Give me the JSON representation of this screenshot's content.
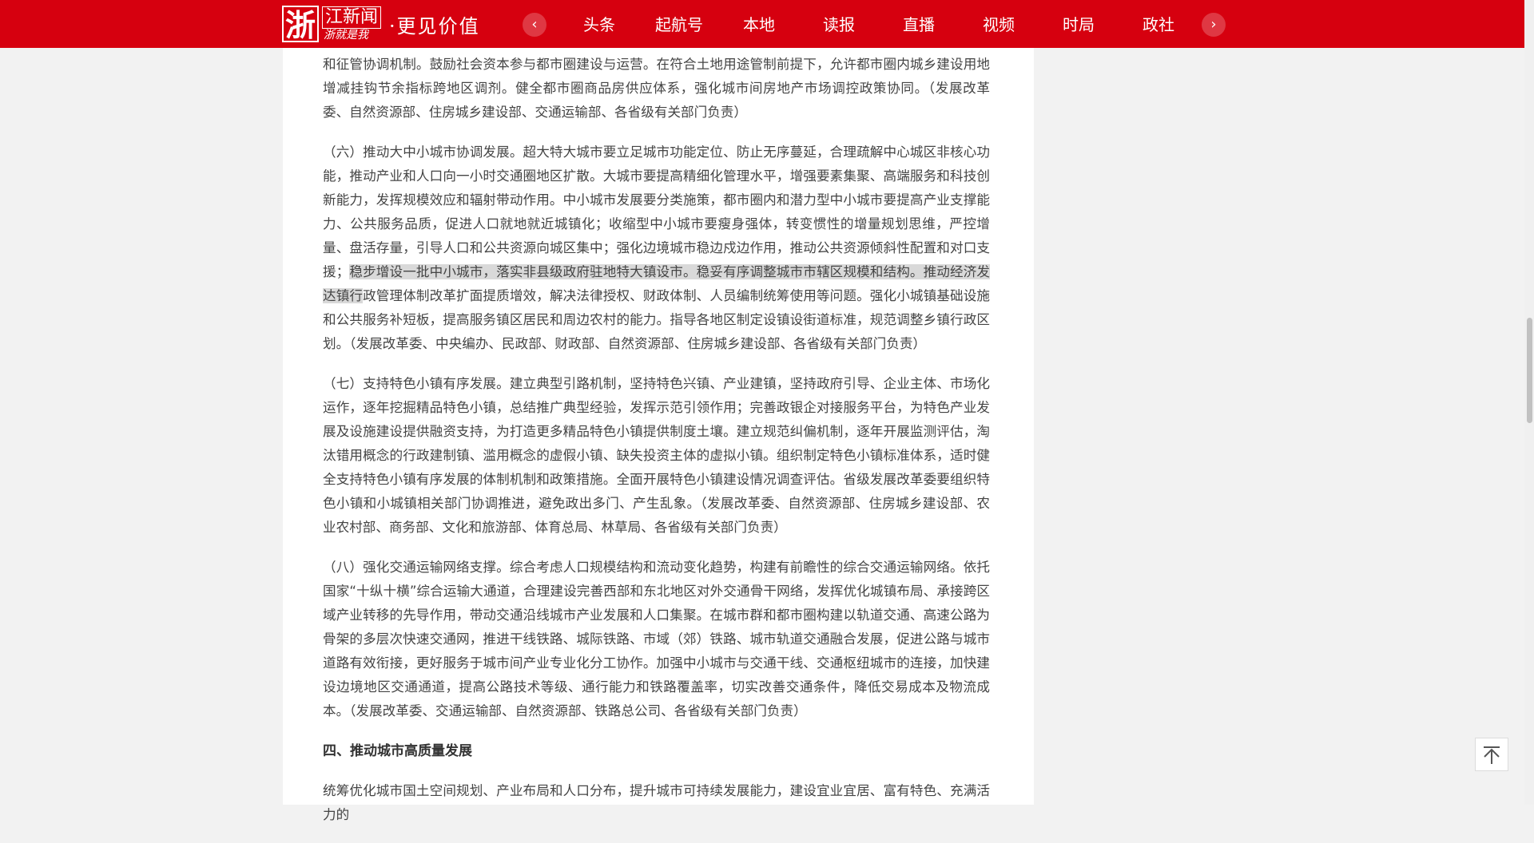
{
  "header": {
    "logo_char": "浙",
    "logo_name": "江新闻",
    "logo_sub": "浙就是我",
    "slogan": "·更见价值",
    "nav": [
      "头条",
      "起航号",
      "本地",
      "读报",
      "直播",
      "视频",
      "时局",
      "政社"
    ],
    "prev_icon": "chevron-left-icon",
    "next_icon": "chevron-right-icon"
  },
  "article": {
    "p0": "和征管协调机制。鼓励社会资本参与都市圈建设与运营。在符合土地用途管制前提下，允许都市圈内城乡建设用地增减挂钩节余指标跨地区调剂。健全都市圈商品房供应体系，强化城市间房地产市场调控政策协同。（发展改革委、自然资源部、住房城乡建设部、交通运输部、各省级有关部门负责）",
    "p1_before": "（六）推动大中小城市协调发展。超大特大城市要立足城市功能定位、防止无序蔓延，合理疏解中心城区非核心功能，推动产业和人口向一小时交通圈地区扩散。大城市要提高精细化管理水平，增强要素集聚、高端服务和科技创新能力，发挥规模效应和辐射带动作用。中小城市发展要分类施策，都市圈内和潜力型中小城市要提高产业支撑能力、公共服务品质，促进人口就地就近城镇化；收缩型中小城市要瘦身强体，转变惯性的增量规划思维，严控增量、盘活存量，引导人口和公共资源向城区集中；强化边境城市稳边戍边作用，推动公共资源倾斜性配置和对口支援；",
    "p1_highlight": "稳步增设一批中小城市，落实非县级政府驻地特大镇设市。稳妥有序调整城市市辖区规模和结构。推动经济发达镇行",
    "p1_after": "政管理体制改革扩面提质增效，解决法律授权、财政体制、人员编制统筹使用等问题。强化小城镇基础设施和公共服务补短板，提高服务镇区居民和周边农村的能力。指导各地区制定设镇设街道标准，规范调整乡镇行政区划。（发展改革委、中央编办、民政部、财政部、自然资源部、住房城乡建设部、各省级有关部门负责）",
    "p2": "（七）支持特色小镇有序发展。建立典型引路机制，坚持特色兴镇、产业建镇，坚持政府引导、企业主体、市场化运作，逐年挖掘精品特色小镇，总结推广典型经验，发挥示范引领作用；完善政银企对接服务平台，为特色产业发展及设施建设提供融资支持，为打造更多精品特色小镇提供制度土壤。建立规范纠偏机制，逐年开展监测评估，淘汰错用概念的行政建制镇、滥用概念的虚假小镇、缺失投资主体的虚拟小镇。组织制定特色小镇标准体系，适时健全支持特色小镇有序发展的体制机制和政策措施。全面开展特色小镇建设情况调查评估。省级发展改革委要组织特色小镇和小城镇相关部门协调推进，避免政出多门、产生乱象。（发展改革委、自然资源部、住房城乡建设部、农业农村部、商务部、文化和旅游部、体育总局、林草局、各省级有关部门负责）",
    "p3": "（八）强化交通运输网络支撑。综合考虑人口规模结构和流动变化趋势，构建有前瞻性的综合交通运输网络。依托国家“十纵十横”综合运输大通道，合理建设完善西部和东北地区对外交通骨干网络，发挥优化城镇布局、承接跨区域产业转移的先导作用，带动交通沿线城市产业发展和人口集聚。在城市群和都市圈构建以轨道交通、高速公路为骨架的多层次快速交通网，推进干线铁路、城际铁路、市域（郊）铁路、城市轨道交通融合发展，促进公路与城市道路有效衔接，更好服务于城市间产业专业化分工协作。加强中小城市与交通干线、交通枢纽城市的连接，加快建设边境地区交通通道，提高公路技术等级、通行能力和铁路覆盖率，切实改善交通条件，降低交易成本及物流成本。（发展改革委、交通运输部、自然资源部、铁路总公司、各省级有关部门负责）",
    "h4": "四、推动城市高质量发展",
    "p4": "统筹优化城市国土空间规划、产业布局和人口分布，提升城市可持续发展能力，建设宜业宜居、富有特色、充满活力的"
  },
  "back_to_top_icon": "arrow-up-to-top-icon"
}
